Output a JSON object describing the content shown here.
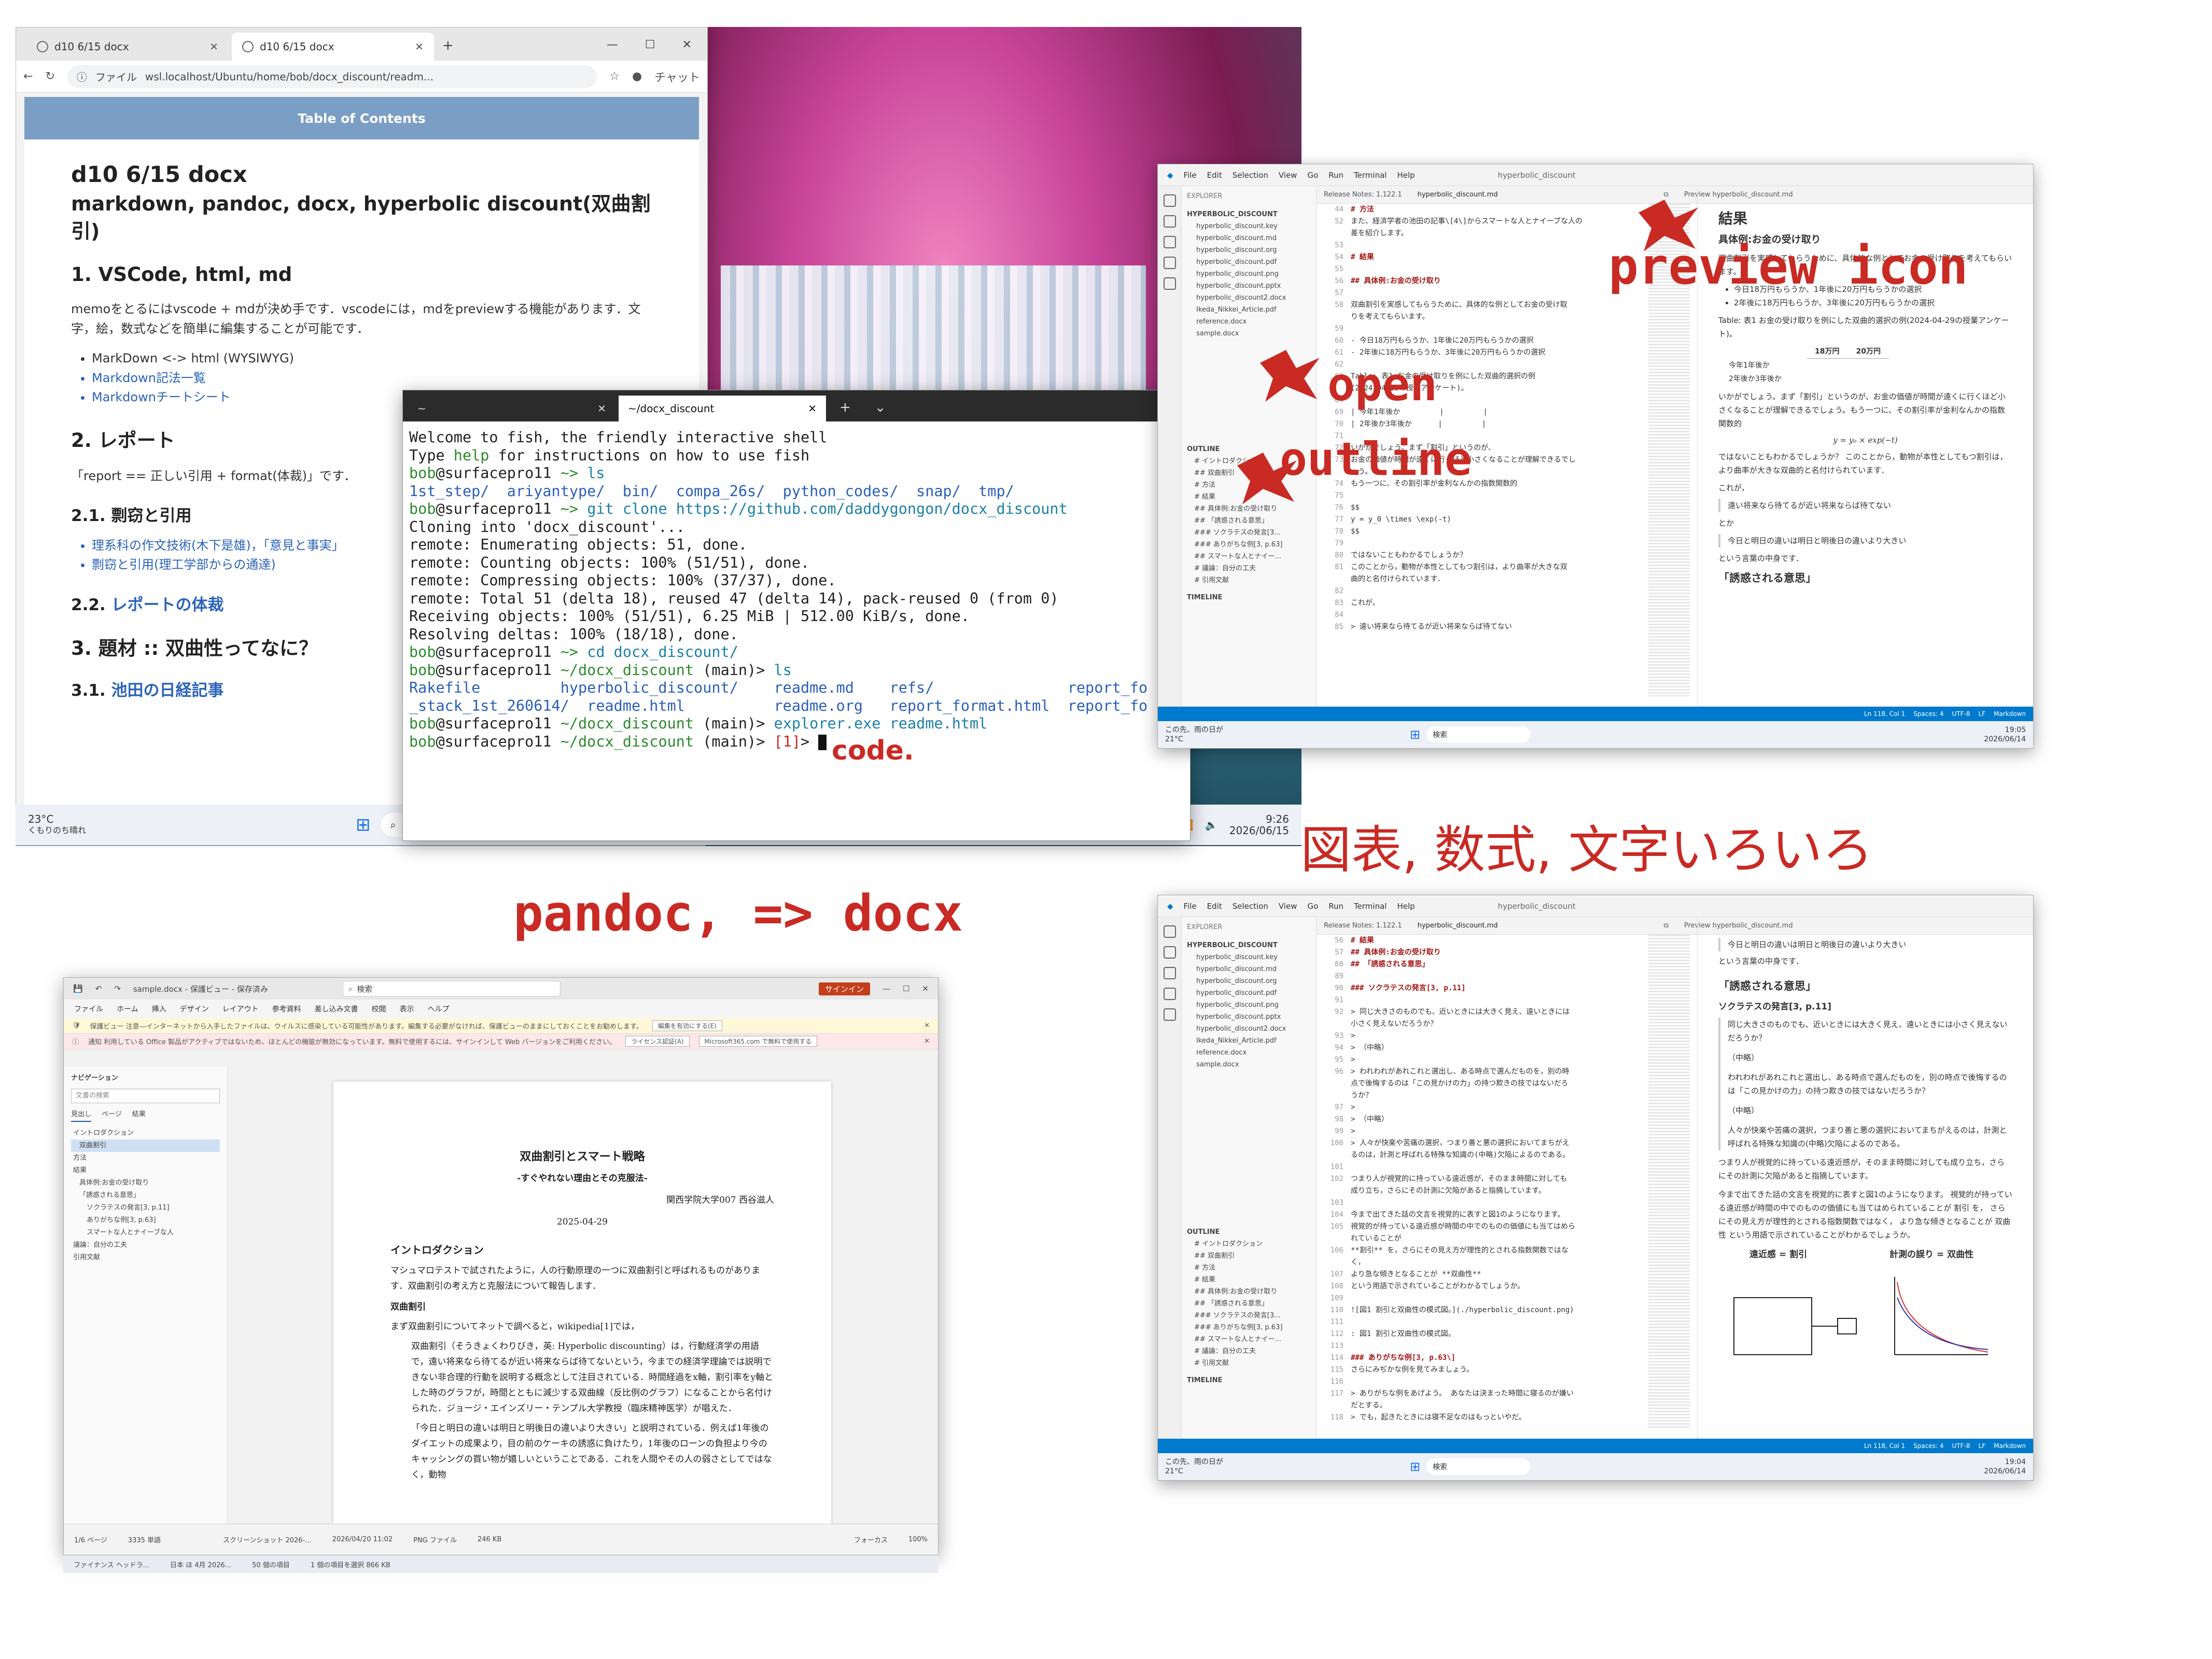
{
  "browser": {
    "tabs": [
      "d10 6/15 docx",
      "d10 6/15 docx"
    ],
    "url_prefix": "ファイル",
    "url": "wsl.localhost/Ubuntu/home/bob/docx_discount/readm...",
    "copilot": "チャット",
    "toc": "Table of Contents",
    "title": "d10 6/15 docx",
    "subtitle": "markdown, pandoc, docx, hyperbolic discount(双曲割引)",
    "h_vscode": "1. VSCode, html, md",
    "p_vscode": "memoをとるにはvscode + mdが決め手です．vscodeには，mdをpreviewする機能があります．文字，絵，数式などを簡単に編集することが可能です．",
    "list1": [
      "MarkDown <-> html (WYSIWYG)",
      "Markdown記法一覧",
      "Markdownチートシート"
    ],
    "h_report": "2. レポート",
    "p_report": "「report == 正しい引用 + format(体裁)」です．",
    "h_plag": "2.1. 剽窃と引用",
    "list2": [
      "理系科の作文技術(木下是雄)，「意見と事実」",
      "剽窃と引用(理工学部からの通達)"
    ],
    "h_format_prefix": "2.2.",
    "h_format_link": "レポートの体裁",
    "h_topic": "3. 題材 :: 双曲性ってなに？",
    "h_nikkei_prefix": "3.1.",
    "h_nikkei_link": "池田の日経記事"
  },
  "terminal": {
    "tabs": [
      "~",
      "~/docx_discount"
    ],
    "lines": {
      "l1": "Welcome to fish, the friendly interactive shell",
      "l2a": "Type ",
      "l2b": "help",
      "l2c": " for instructions on how to use fish",
      "prompt_user": "bob",
      "prompt_host": "@surfacepro11",
      "home": " ~> ",
      "cmd_ls": "ls",
      "ls_home": "1st_step/  ariyantype/  bin/  compa_26s/  python_codes/  snap/  tmp/",
      "cmd_clone": "git clone https://github.com/daddygongon/docx_discount",
      "clone1": "Cloning into 'docx_discount'...",
      "clone2": "remote: Enumerating objects: 51, done.",
      "clone3": "remote: Counting objects: 100% (51/51), done.",
      "clone4": "remote: Compressing objects: 100% (37/37), done.",
      "clone5": "remote: Total 51 (delta 18), reused 47 (delta 14), pack-reused 0 (from 0)",
      "clone6": "Receiving objects: 100% (51/51), 6.25 MiB | 512.00 KiB/s, done.",
      "clone7": "Resolving deltas: 100% (18/18), done.",
      "cmd_cd": "cd docx_discount/",
      "dir": " ~/docx_discount",
      "branch": " (main)> ",
      "ls_repo1": "Rakefile         hyperbolic_discount/    readme.md    refs/               report_fo",
      "ls_repo2": "_stack_1st_260614/  readme.html          readme.org   report_format.html  report_fo",
      "cmd_explorer": "explorer.exe readme.html",
      "status1": "[1]",
      "prompt_end": "> "
    }
  },
  "taskbar_main": {
    "weather_temp": "23°C",
    "weather_text": "くもりのち晴れ",
    "search": "検索",
    "time": "9:26",
    "date": "2026/06/15"
  },
  "vscode_top": {
    "menu": [
      "File",
      "Edit",
      "Selection",
      "View",
      "Go",
      "Run",
      "Terminal",
      "Help"
    ],
    "title": "hyperbolic_discount",
    "explorer": "EXPLORER",
    "folder": "HYPERBOLIC_DISCOUNT",
    "files": [
      "hyperbolic_discount.key",
      "hyperbolic_discount.md",
      "hyperbolic_discount.org",
      "hyperbolic_discount.pdf",
      "hyperbolic_discount.png",
      "hyperbolic_discount.pptx",
      "hyperbolic_discount2.docx",
      "Ikeda_Nikkei_Article.pdf",
      "reference.docx",
      "sample.docx"
    ],
    "outline": "OUTLINE",
    "outline_items": [
      "# イントロダクション",
      "## 双曲割引",
      "# 方法",
      "# 結果",
      "## 具体例:お金の受け取り",
      "## 「誘惑される意思」",
      "### ソクラテスの発言[3...",
      "### ありがちな例[3, p.63]",
      "## スマートな人とナイー...",
      "# 議論：自分の工夫",
      "# 引用文献"
    ],
    "timeline": "TIMELINE",
    "tab_release": "Release Notes: 1.122.1",
    "tab_md": "hyperbolic_discount.md",
    "tab_preview": "Preview hyperbolic_discount.md",
    "code": [
      {
        "n": "44",
        "t": "# 方法",
        "k": true
      },
      {
        "n": "52",
        "t": "また、経済学者の池田の記事\\[4\\]からスマートな人とナイーブな人の",
        "k": false
      },
      {
        "n": "",
        "t": "差を紹介します。",
        "k": false
      },
      {
        "n": "53",
        "t": "",
        "k": false
      },
      {
        "n": "54",
        "t": "# 結果",
        "k": true
      },
      {
        "n": "55",
        "t": "",
        "k": false
      },
      {
        "n": "56",
        "t": "## 具体例:お金の受け取り",
        "k": true
      },
      {
        "n": "57",
        "t": "",
        "k": false
      },
      {
        "n": "58",
        "t": "双曲割引を実感してもらうために、具体的な例としてお金の受け取",
        "k": false
      },
      {
        "n": "",
        "t": "りを考えてもらいます。",
        "k": false
      },
      {
        "n": "59",
        "t": "",
        "k": false
      },
      {
        "n": "60",
        "t": "- 今日18万円もらうか、1年後に20万円もらうかの選択",
        "k": false
      },
      {
        "n": "61",
        "t": "- 2年後に18万円もらうか、3年後に20万円もらうかの選択",
        "k": false
      },
      {
        "n": "62",
        "t": "",
        "k": false
      },
      {
        "n": "63",
        "t": "Table: 表1 お金の受け取りを例にした双曲的選択の例",
        "k": false
      },
      {
        "n": "",
        "t": "(2024-04-29の授業アンケート)。",
        "k": false
      },
      {
        "n": "64",
        "t": "",
        "k": false
      },
      {
        "n": "69",
        "t": "| 今年1年後か         |         |",
        "k": false
      },
      {
        "n": "70",
        "t": "| 2年後か3年後か      |         |",
        "k": false
      },
      {
        "n": "71",
        "t": "",
        "k": false
      },
      {
        "n": "72",
        "t": "いかがでしょう。まず「割引」というのが、",
        "k": false
      },
      {
        "n": "73",
        "t": "お金の価値が時間が遠くに行くほど小さくなることが理解できるでし",
        "k": false
      },
      {
        "n": "",
        "t": "ょう。",
        "k": false
      },
      {
        "n": "74",
        "t": "もう一つに、その割引率が金利なんかの指数関数的",
        "k": false
      },
      {
        "n": "75",
        "t": "",
        "k": false
      },
      {
        "n": "76",
        "t": "$$",
        "k": false
      },
      {
        "n": "77",
        "t": "y = y_0 \\times \\exp(-t)",
        "k": false
      },
      {
        "n": "78",
        "t": "$$",
        "k": false
      },
      {
        "n": "79",
        "t": "",
        "k": false
      },
      {
        "n": "80",
        "t": "ではないこともわかるでしょうか？",
        "k": false
      },
      {
        "n": "81",
        "t": "このことから，動物が本性としてもつ割引は，より曲率が大きな双",
        "k": false
      },
      {
        "n": "",
        "t": "曲的と名付けられています．",
        "k": false
      },
      {
        "n": "82",
        "t": "",
        "k": false
      },
      {
        "n": "83",
        "t": "これが，",
        "k": false
      },
      {
        "n": "84",
        "t": "",
        "k": false
      },
      {
        "n": "85",
        "t": "> 遠い将来なら待てるが近い将来ならば待てない",
        "k": false
      }
    ],
    "preview": {
      "h_result": "結果",
      "h_example": "具体例:お金の受け取り",
      "p1": "双曲割引を実感してもらうために、具体的な例としてお金の受け取りを考えてもらいます。",
      "li": [
        "今日18万円もらうか、1年後に20万円もらうかの選択",
        "2年後に18万円もらうか、3年後に20万円もらうかの選択"
      ],
      "table_caption": "Table: 表1 お金の受け取りを例にした双曲的選択の例(2024-04-29の授業アンケート)。",
      "th1": "18万円",
      "th2": "20万円",
      "row1": "今年1年後か",
      "row2": "2年後か3年後か",
      "p2": "いかがでしょう。まず「割引」というのが、お金の価値が時間が遠くに行くほど小さくなることが理解できるでしょう。もう一つに、その割引率が金利なんかの指数関数的",
      "formula": "y = y₀ × exp(−t)",
      "p3": "ではないこともわかるでしょうか？ このことから，動物が本性としてもつ割引は，より曲率が大きな双曲的と名付けられています．",
      "p4": "これが，",
      "q1": "遠い将来なら待てるが近い将来ならば待てない",
      "p5": "とか",
      "q2": "今日と明日の違いは明日と明後日の違いより大きい",
      "p6": "という言葉の中身です．",
      "h_temptation": "「誘惑される意思」"
    },
    "status": [
      "Ln 118, Col 1",
      "Spaces: 4",
      "UTF-8",
      "LF",
      "Markdown"
    ],
    "task_weather": "この先、雨の日が",
    "task_temp": "21°C",
    "task_search": "検索",
    "time": "19:05",
    "date": "2026/06/14"
  },
  "vscode_bottom": {
    "code": [
      {
        "n": "56",
        "t": "# 結果",
        "k": true
      },
      {
        "n": "57",
        "t": "## 具体例:お金の受け取り",
        "k": true
      },
      {
        "n": "88",
        "t": "## 「誘惑される意思」",
        "k": true
      },
      {
        "n": "89",
        "t": "",
        "k": false
      },
      {
        "n": "90",
        "t": "### ソクラテスの発言[3, p.11]",
        "k": true
      },
      {
        "n": "91",
        "t": "",
        "k": false
      },
      {
        "n": "92",
        "t": "> 同じ大きさのものでも、近いときには大きく見え、遠いときには",
        "k": false
      },
      {
        "n": "",
        "t": "小さく見えないだろうか？",
        "k": false
      },
      {
        "n": "93",
        "t": ">",
        "k": false
      },
      {
        "n": "94",
        "t": "> （中略）",
        "k": false
      },
      {
        "n": "95",
        "t": ">",
        "k": false
      },
      {
        "n": "96",
        "t": "> われわれがあれこれと選出し、ある時点で選んだものを，別の時",
        "k": false
      },
      {
        "n": "",
        "t": "点で後悔するのは「この見かけの力」の持つ欺きの技ではないだろ",
        "k": false
      },
      {
        "n": "",
        "t": "うか？",
        "k": false
      },
      {
        "n": "97",
        "t": ">",
        "k": false
      },
      {
        "n": "98",
        "t": "> （中略）",
        "k": false
      },
      {
        "n": "99",
        "t": ">",
        "k": false
      },
      {
        "n": "100",
        "t": "> 人々が快楽や苦痛の選択，つまり善と悪の選択においてまちがえ",
        "k": false
      },
      {
        "n": "",
        "t": "るのは，計測と呼ばれる特殊な知識の(中略)欠陥によるのである。",
        "k": false
      },
      {
        "n": "101",
        "t": "",
        "k": false
      },
      {
        "n": "102",
        "t": "つまり人が視覚的に持っている遠近感が，そのまま時間に対しても",
        "k": false
      },
      {
        "n": "",
        "t": "成り立ち，さらにその計測に欠陥があると指摘しています。",
        "k": false
      },
      {
        "n": "103",
        "t": "",
        "k": false
      },
      {
        "n": "104",
        "t": "今まで出てきた話の文言を視覚的に表すと図1のようになります。",
        "k": false
      },
      {
        "n": "105",
        "t": "視覚的が持っている遠近感が時間の中でのものの価値にも当てはめら",
        "k": false
      },
      {
        "n": "",
        "t": "れていることが",
        "k": false
      },
      {
        "n": "106",
        "t": "**割引** を，さらにその見え方が理性的とされる指数関数ではな",
        "k": false
      },
      {
        "n": "",
        "t": "く，",
        "k": false
      },
      {
        "n": "107",
        "t": "より急な傾きとなることが **双曲性**",
        "k": false
      },
      {
        "n": "108",
        "t": "という用語で示されていることがわかるでしょうか。",
        "k": false
      },
      {
        "n": "109",
        "t": "",
        "k": false
      },
      {
        "n": "110",
        "t": "![図1 割引と双曲性の模式図。](./hyperbolic_discount.png)",
        "k": false
      },
      {
        "n": "111",
        "t": "",
        "k": false
      },
      {
        "n": "112",
        "t": ": 図1 割引と双曲性の模式図。",
        "k": false
      },
      {
        "n": "113",
        "t": "",
        "k": false
      },
      {
        "n": "114",
        "t": "### ありがちな例[3, p.63\\]",
        "k": true
      },
      {
        "n": "115",
        "t": "さらにみぢかな例を見てみましょう。",
        "k": false
      },
      {
        "n": "116",
        "t": "",
        "k": false
      },
      {
        "n": "117",
        "t": "> ありがちな例をあげよう。 あなたは決まった時間に寝るのが嫌い",
        "k": false
      },
      {
        "n": "",
        "t": "だとする。",
        "k": false
      },
      {
        "n": "118",
        "t": "> でも，起きたときには寝不足なのはもっといやだ。",
        "k": false
      }
    ],
    "preview": {
      "q_top": "今日と明日の違いは明日と明後日の違いより大きい",
      "p_top": "という言葉の中身です．",
      "h_temptation": "「誘惑される意思」",
      "h_socrates": "ソクラテスの発言[3, p.11]",
      "q1": "同じ大きさのものでも、近いときには大きく見え、遠いときには小さく見えないだろうか？",
      "mid1": "（中略）",
      "q2": "われわれがあれこれと選出し、ある時点で選んだものを，別の時点で後悔するのは「この見かけの力」の持つ欺きの技ではないだろうか？",
      "mid2": "（中略）",
      "q3": "人々が快楽や苦痛の選択，つまり善と悪の選択においてまちがえるのは，計測と呼ばれる特殊な知識の(中略)欠陥によるのである。",
      "p1": "つまり人が視覚的に持っている遠近感が，そのまま時間に対しても成り立ち，さらにその計測に欠陥があると指摘しています。",
      "p2": "今まで出てきた話の文言を視覚的に表すと図1のようになります。 視覚的が持っている遠近感が時間の中でのものの価値にも当てはめられていることが 割引 を， さらにその見え方が理性的とされる指数関数ではなく， より急な傾きとなることが 双曲性 という用語で示されていることがわかるでしょうか。",
      "fig_left": "遠近感 = 割引",
      "fig_right": "計測の誤り = 双曲性"
    },
    "time": "19:04",
    "date": "2026/06/14"
  },
  "word": {
    "title": "sample.docx - 保護ビュー - 保存済み",
    "search": "検索",
    "signin": "サインイン",
    "ribbon": [
      "ファイル",
      "ホーム",
      "挿入",
      "デザイン",
      "レイアウト",
      "参考資料",
      "差し込み文書",
      "校閲",
      "表示",
      "ヘルプ"
    ],
    "warn1": "保護ビュー  注意—インターネットから入手したファイルは、ウイルスに感染している可能性があります。編集する必要がなければ、保護ビューのままにしておくことをお勧めします。",
    "warn1_btn": "編集を有効にする(E)",
    "warn2": "通知  利用している Office 製品がアクティブではないため、ほとんどの機能が無効になっています。無料で使用するには、サインインして Web バージョンをご利用ください。",
    "warn2_btn1": "ライセンス認証(A)",
    "warn2_btn2": "Microsoft365.com で無料で使用する",
    "nav_title": "ナビゲーション",
    "nav_search": "文書の検索",
    "nav_tabs": [
      "見出し",
      "ページ",
      "結果"
    ],
    "nav_items": [
      "イントロダクション",
      "双曲割引",
      "方法",
      "結果",
      "具体例:お金の受け取り",
      "「誘惑される意思」",
      "ソクラテスの発言[3, p.11]",
      "ありがちな例[3, p.63]",
      "スマートな人とナイーブな人",
      "議論：自分の工夫",
      "引用文献"
    ],
    "doc_title": "双曲割引とスマート戦略",
    "doc_subtitle": "-すぐやれない理由とその克服法-",
    "doc_author": "関西学院大学007 西谷滋人",
    "doc_date": "2025-04-29",
    "doc_h1": "イントロダクション",
    "doc_p1": "マシュマロテストで試されたように，人の行動原理の一つに双曲割引と呼ばれるものがあります．双曲割引の考え方と克服法について報告します．",
    "doc_h2": "双曲割引",
    "doc_p2": "まず双曲割引についてネットで調べると，wikipedia[1]では，",
    "doc_q": "双曲割引（そうきょくわりびき，英: Hyperbolic discounting）は，行動経済学の用語で，遠い将来なら待てるが近い将来ならば待てないという，今までの経済学理論では説明できない非合理的行動を説明する概念として注目されている．時間経過をx軸，割引率をy軸とした時のグラフが，時間とともに減少する双曲線（反比例のグラフ）になることから名付けられた．ジョージ・エインズリー・テンプル大学教授（臨床精神医学）が唱えた．",
    "doc_q2": "「今日と明日の違いは明日と明後日の違いより大きい」と説明されている．例えば1年後のダイエットの成果より，目の前のケーキの誘惑に負けたり，1年後のローンの負担より今のキャッシングの買い物が嬉しいということである．これを人間やその人の弱さとしてではなく，動物",
    "status_page": "1/6 ページ",
    "status_words": "3335 単語",
    "status_focus": "フォーカス",
    "zoom": "100%",
    "explorer_task": "ファイナンス ヘッドラ...",
    "explorer_sub": "日本 ほ 4月 2026...",
    "file_row": "スクリーンショット 2026-...",
    "file_date": "2026/04/20 11:02",
    "file_type": "PNG ファイル",
    "file_size": "246 KB",
    "items_count": "50 個の項目",
    "selected": "1 個の項目を選択 866 KB"
  },
  "annotations": {
    "preview_icon": "preview icon",
    "open": "open",
    "outline": "outline",
    "code": "code.",
    "figures": "図表, 数式, 文字いろいろ",
    "pandoc": "pandoc, => docx"
  },
  "colors": {
    "annotation_red": "#c92a24",
    "vscode_blue": "#007acc",
    "toc_blue": "#7b9ec5",
    "fish_green": "#2b8a2b",
    "fish_cyan": "#1b7fa8"
  }
}
